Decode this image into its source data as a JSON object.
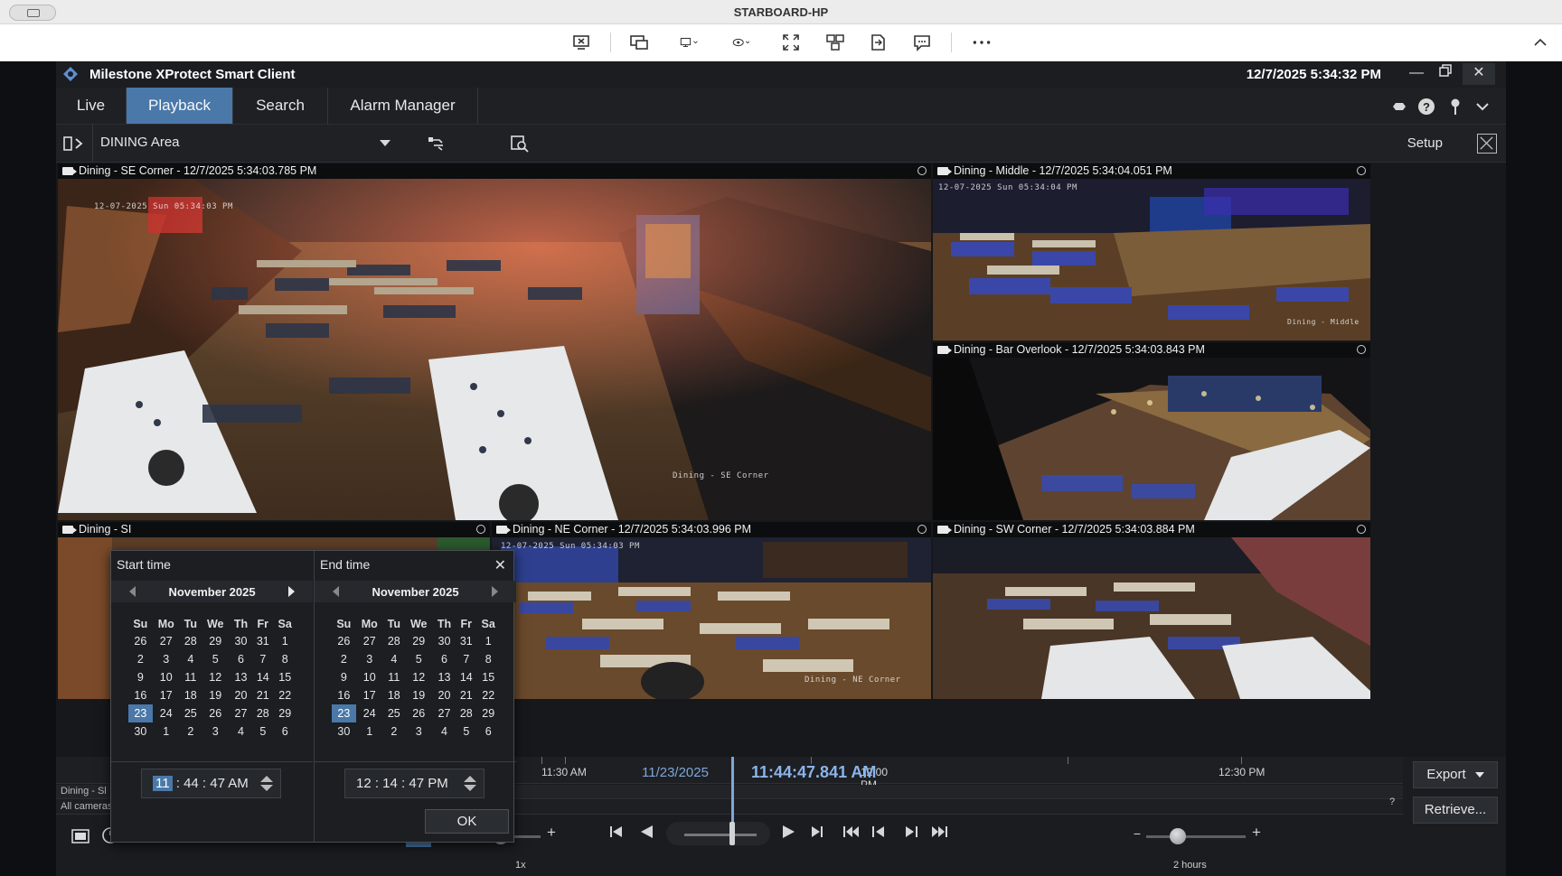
{
  "remote_window": {
    "title": "STARBOARD-HP"
  },
  "app": {
    "title": "Milestone XProtect Smart Client",
    "datetime": "12/7/2025 5:34:32 PM",
    "tabs": [
      "Live",
      "Playback",
      "Search",
      "Alarm Manager"
    ],
    "active_tab": "Playback"
  },
  "view": {
    "name": "DINING Area",
    "setup_label": "Setup"
  },
  "cameras": [
    {
      "title": "Dining - SE Corner - 12/7/2025 5:34:03.785 PM",
      "osd_date": "12-07-2025 Sun 05:34:03 PM",
      "osd_name": "Dining - SE Corner"
    },
    {
      "title": "Dining - Middle - 12/7/2025 5:34:04.051 PM",
      "osd_date": "12-07-2025 Sun 05:34:04 PM",
      "osd_name": "Dining - Middle"
    },
    {
      "title": "Dining - Bar Overlook - 12/7/2025 5:34:03.843 PM"
    },
    {
      "title": "Dining - NE Corner - 12/7/2025 5:34:03.996 PM",
      "osd_date": "12-07-2025 Sun 05:34:03 PM",
      "osd_name": "Dining - NE Corner"
    },
    {
      "title": "Dining - SW Corner - 12/7/2025 5:34:03.884 PM"
    },
    {
      "title": "Dining - SI"
    }
  ],
  "timeline": {
    "labels": [
      "11:30 AM",
      "12:00 PM",
      "12:30 PM"
    ],
    "date": "11/23/2025",
    "current_time": "11:44:47.841 AM",
    "row_camera": "Dining - Sl",
    "row_all": "All cameras",
    "help": "?",
    "speed": "1x",
    "speed_box": "1x",
    "span": "2 hours",
    "export_label": "Export",
    "retrieve_label": "Retrieve..."
  },
  "time_dialog": {
    "start_label": "Start time",
    "end_label": "End time",
    "month": "November 2025",
    "weekdays": [
      "Su",
      "Mo",
      "Tu",
      "We",
      "Th",
      "Fr",
      "Sa"
    ],
    "weeks": [
      [
        "26",
        "27",
        "28",
        "29",
        "30",
        "31",
        "1"
      ],
      [
        "2",
        "3",
        "4",
        "5",
        "6",
        "7",
        "8"
      ],
      [
        "9",
        "10",
        "11",
        "12",
        "13",
        "14",
        "15"
      ],
      [
        "16",
        "17",
        "18",
        "19",
        "20",
        "21",
        "22"
      ],
      [
        "23",
        "24",
        "25",
        "26",
        "27",
        "28",
        "29"
      ],
      [
        "30",
        "1",
        "2",
        "3",
        "4",
        "5",
        "6"
      ]
    ],
    "selected_day": "23",
    "start_time": {
      "hour": "11",
      "rest": ": 44 : 47  AM"
    },
    "end_time": "12 : 14 : 47  PM",
    "ok_label": "OK"
  },
  "colors": {
    "accent": "#4a78a8",
    "selection_outline": "#4e87c8",
    "timeline_text": "#8bb4ea"
  }
}
